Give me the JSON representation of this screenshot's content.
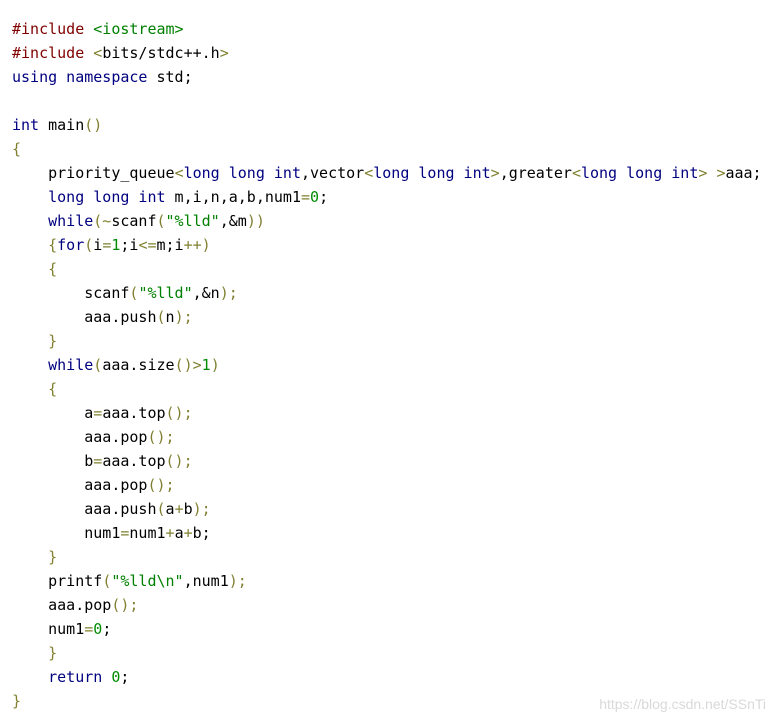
{
  "colors": {
    "default": "#000000",
    "preprocessor": "#800000",
    "keyword": "#000080",
    "string": "#008000",
    "operator": "#808030",
    "number": "#008c00",
    "bracket": "#808030",
    "watermark": "#d9d9d9",
    "background": "#ffffff"
  },
  "code_lines": [
    [
      {
        "t": "#include ",
        "c": "preprocessor"
      },
      {
        "t": "<iostream>",
        "c": "string"
      }
    ],
    [
      {
        "t": "#include ",
        "c": "preprocessor"
      },
      {
        "t": "<",
        "c": "operator"
      },
      {
        "t": "bits/stdc++.h",
        "c": "default"
      },
      {
        "t": ">",
        "c": "operator"
      }
    ],
    [
      {
        "t": "using namespace",
        "c": "keyword"
      },
      {
        "t": " std;",
        "c": "default"
      }
    ],
    [],
    [
      {
        "t": "int",
        "c": "keyword"
      },
      {
        "t": " main",
        "c": "default"
      },
      {
        "t": "()",
        "c": "bracket"
      }
    ],
    [
      {
        "t": "{",
        "c": "bracket"
      }
    ],
    [
      {
        "t": "    priority_queue",
        "c": "default"
      },
      {
        "t": "<",
        "c": "operator"
      },
      {
        "t": "long long int",
        "c": "keyword"
      },
      {
        "t": ",vector",
        "c": "default"
      },
      {
        "t": "<",
        "c": "operator"
      },
      {
        "t": "long long int",
        "c": "keyword"
      },
      {
        "t": ">",
        "c": "operator"
      },
      {
        "t": ",greater",
        "c": "default"
      },
      {
        "t": "<",
        "c": "operator"
      },
      {
        "t": "long long int",
        "c": "keyword"
      },
      {
        "t": ">",
        "c": "operator"
      },
      {
        "t": " ",
        "c": "default"
      },
      {
        "t": ">",
        "c": "operator"
      },
      {
        "t": "aaa;",
        "c": "default"
      }
    ],
    [
      {
        "t": "    long long int",
        "c": "keyword"
      },
      {
        "t": " m,i,n,a,b,num1",
        "c": "default"
      },
      {
        "t": "=",
        "c": "operator"
      },
      {
        "t": "0",
        "c": "number"
      },
      {
        "t": ";",
        "c": "default"
      }
    ],
    [
      {
        "t": "    while",
        "c": "keyword"
      },
      {
        "t": "(~",
        "c": "operator"
      },
      {
        "t": "scanf",
        "c": "default"
      },
      {
        "t": "(",
        "c": "bracket"
      },
      {
        "t": "\"%lld\"",
        "c": "string"
      },
      {
        "t": ",&m",
        "c": "default"
      },
      {
        "t": "))",
        "c": "bracket"
      }
    ],
    [
      {
        "t": "    {",
        "c": "bracket"
      },
      {
        "t": "for",
        "c": "keyword"
      },
      {
        "t": "(",
        "c": "bracket"
      },
      {
        "t": "i",
        "c": "default"
      },
      {
        "t": "=",
        "c": "operator"
      },
      {
        "t": "1",
        "c": "number"
      },
      {
        "t": ";i",
        "c": "default"
      },
      {
        "t": "<=",
        "c": "operator"
      },
      {
        "t": "m;i",
        "c": "default"
      },
      {
        "t": "++",
        "c": "operator"
      },
      {
        "t": ")",
        "c": "bracket"
      }
    ],
    [
      {
        "t": "    {",
        "c": "bracket"
      }
    ],
    [
      {
        "t": "        scanf",
        "c": "default"
      },
      {
        "t": "(",
        "c": "bracket"
      },
      {
        "t": "\"%lld\"",
        "c": "string"
      },
      {
        "t": ",&n",
        "c": "default"
      },
      {
        "t": ");",
        "c": "bracket"
      }
    ],
    [
      {
        "t": "        aaa.push",
        "c": "default"
      },
      {
        "t": "(",
        "c": "bracket"
      },
      {
        "t": "n",
        "c": "default"
      },
      {
        "t": ");",
        "c": "bracket"
      }
    ],
    [
      {
        "t": "    }",
        "c": "bracket"
      }
    ],
    [
      {
        "t": "    while",
        "c": "keyword"
      },
      {
        "t": "(",
        "c": "bracket"
      },
      {
        "t": "aaa.size",
        "c": "default"
      },
      {
        "t": "()",
        "c": "bracket"
      },
      {
        "t": ">",
        "c": "operator"
      },
      {
        "t": "1",
        "c": "number"
      },
      {
        "t": ")",
        "c": "bracket"
      }
    ],
    [
      {
        "t": "    {",
        "c": "bracket"
      }
    ],
    [
      {
        "t": "        a",
        "c": "default"
      },
      {
        "t": "=",
        "c": "operator"
      },
      {
        "t": "aaa.top",
        "c": "default"
      },
      {
        "t": "();",
        "c": "bracket"
      }
    ],
    [
      {
        "t": "        aaa.pop",
        "c": "default"
      },
      {
        "t": "();",
        "c": "bracket"
      }
    ],
    [
      {
        "t": "        b",
        "c": "default"
      },
      {
        "t": "=",
        "c": "operator"
      },
      {
        "t": "aaa.top",
        "c": "default"
      },
      {
        "t": "();",
        "c": "bracket"
      }
    ],
    [
      {
        "t": "        aaa.pop",
        "c": "default"
      },
      {
        "t": "();",
        "c": "bracket"
      }
    ],
    [
      {
        "t": "        aaa.push",
        "c": "default"
      },
      {
        "t": "(",
        "c": "bracket"
      },
      {
        "t": "a",
        "c": "default"
      },
      {
        "t": "+",
        "c": "operator"
      },
      {
        "t": "b",
        "c": "default"
      },
      {
        "t": ");",
        "c": "bracket"
      }
    ],
    [
      {
        "t": "        num1",
        "c": "default"
      },
      {
        "t": "=",
        "c": "operator"
      },
      {
        "t": "num1",
        "c": "default"
      },
      {
        "t": "+",
        "c": "operator"
      },
      {
        "t": "a",
        "c": "default"
      },
      {
        "t": "+",
        "c": "operator"
      },
      {
        "t": "b;",
        "c": "default"
      }
    ],
    [
      {
        "t": "    }",
        "c": "bracket"
      }
    ],
    [
      {
        "t": "    printf",
        "c": "default"
      },
      {
        "t": "(",
        "c": "bracket"
      },
      {
        "t": "\"%lld\\n\"",
        "c": "string"
      },
      {
        "t": ",num1",
        "c": "default"
      },
      {
        "t": ");",
        "c": "bracket"
      }
    ],
    [
      {
        "t": "    aaa.pop",
        "c": "default"
      },
      {
        "t": "();",
        "c": "bracket"
      }
    ],
    [
      {
        "t": "    num1",
        "c": "default"
      },
      {
        "t": "=",
        "c": "operator"
      },
      {
        "t": "0",
        "c": "number"
      },
      {
        "t": ";",
        "c": "default"
      }
    ],
    [
      {
        "t": "    }",
        "c": "bracket"
      }
    ],
    [
      {
        "t": "    return",
        "c": "keyword"
      },
      {
        "t": " ",
        "c": "default"
      },
      {
        "t": "0",
        "c": "number"
      },
      {
        "t": ";",
        "c": "default"
      }
    ],
    [
      {
        "t": "}",
        "c": "bracket"
      }
    ]
  ],
  "watermark": "https://blog.csdn.net/SSnTi"
}
